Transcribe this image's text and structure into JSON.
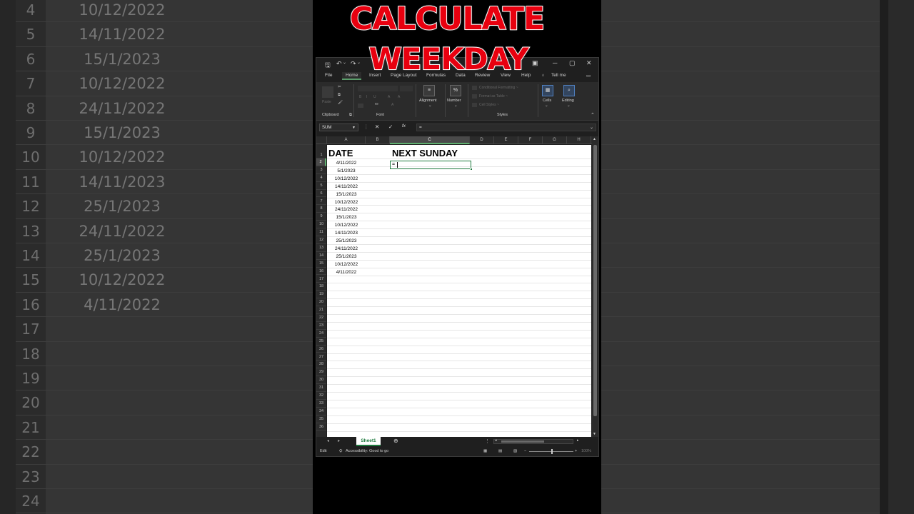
{
  "overlay": {
    "title_line1": "CALCULATE",
    "title_line2": "WEEKDAY"
  },
  "background": {
    "rows": [
      {
        "num": "4",
        "date": "10/12/2022"
      },
      {
        "num": "5",
        "date": "14/11/2022"
      },
      {
        "num": "6",
        "date": "15/1/2023"
      },
      {
        "num": "7",
        "date": "10/12/2022"
      },
      {
        "num": "8",
        "date": "24/11/2022"
      },
      {
        "num": "9",
        "date": "15/1/2023"
      },
      {
        "num": "10",
        "date": "10/12/2022"
      },
      {
        "num": "11",
        "date": "14/11/2023"
      },
      {
        "num": "12",
        "date": "25/1/2023"
      },
      {
        "num": "13",
        "date": "24/11/2022"
      },
      {
        "num": "14",
        "date": "25/1/2023"
      },
      {
        "num": "15",
        "date": "10/12/2022"
      },
      {
        "num": "16",
        "date": "4/11/2022"
      },
      {
        "num": "17",
        "date": ""
      },
      {
        "num": "18",
        "date": ""
      },
      {
        "num": "19",
        "date": ""
      },
      {
        "num": "20",
        "date": ""
      },
      {
        "num": "21",
        "date": ""
      },
      {
        "num": "22",
        "date": ""
      },
      {
        "num": "23",
        "date": ""
      },
      {
        "num": "24",
        "date": ""
      }
    ]
  },
  "ribbon_tabs": [
    "File",
    "Home",
    "Insert",
    "Page Layout",
    "Formulas",
    "Data",
    "Review",
    "View",
    "Help",
    "Tell me"
  ],
  "ribbon": {
    "paste": "Paste",
    "clipboard": "Clipboard",
    "font": "Font",
    "alignment": "Alignment",
    "number": "Number",
    "number_icon": "%",
    "conditional_formatting": "Conditional Formatting ~",
    "format_as_table": "Format as Table ~",
    "cell_styles": "Cell Styles ~",
    "styles": "Styles",
    "cells": "Cells",
    "editing": "Editing"
  },
  "formula_bar": {
    "name_box": "SUM",
    "cancel": "✕",
    "enter": "✓",
    "fx": "fx",
    "formula": "="
  },
  "columns": [
    "A",
    "B",
    "C",
    "D",
    "E",
    "F",
    "G",
    "H"
  ],
  "selected_column": "C",
  "row_numbers": [
    "1",
    "2",
    "3",
    "4",
    "5",
    "6",
    "7",
    "8",
    "9",
    "10",
    "11",
    "12",
    "13",
    "14",
    "15",
    "16",
    "17",
    "18",
    "19",
    "20",
    "21",
    "22",
    "23",
    "24",
    "25",
    "26",
    "27",
    "28",
    "29",
    "30",
    "31",
    "32",
    "33",
    "34",
    "35",
    "36"
  ],
  "headers": {
    "date": "DATE",
    "next_sunday": "NEXT SUNDAY"
  },
  "dates": [
    "4/11/2022",
    "5/1/2023",
    "10/12/2022",
    "14/11/2022",
    "15/1/2023",
    "10/12/2022",
    "24/11/2022",
    "15/1/2023",
    "10/12/2022",
    "14/11/2023",
    "25/1/2023",
    "24/11/2022",
    "25/1/2023",
    "10/12/2022",
    "4/11/2022"
  ],
  "active_cell": {
    "value": "="
  },
  "sheet_tab": "Sheet1",
  "status": {
    "mode": "Edit",
    "accessibility": "Accessibility: Good to go",
    "zoom": "100%"
  },
  "colors": {
    "accent_green": "#1e7a3e",
    "title_red": "#e8000f"
  }
}
